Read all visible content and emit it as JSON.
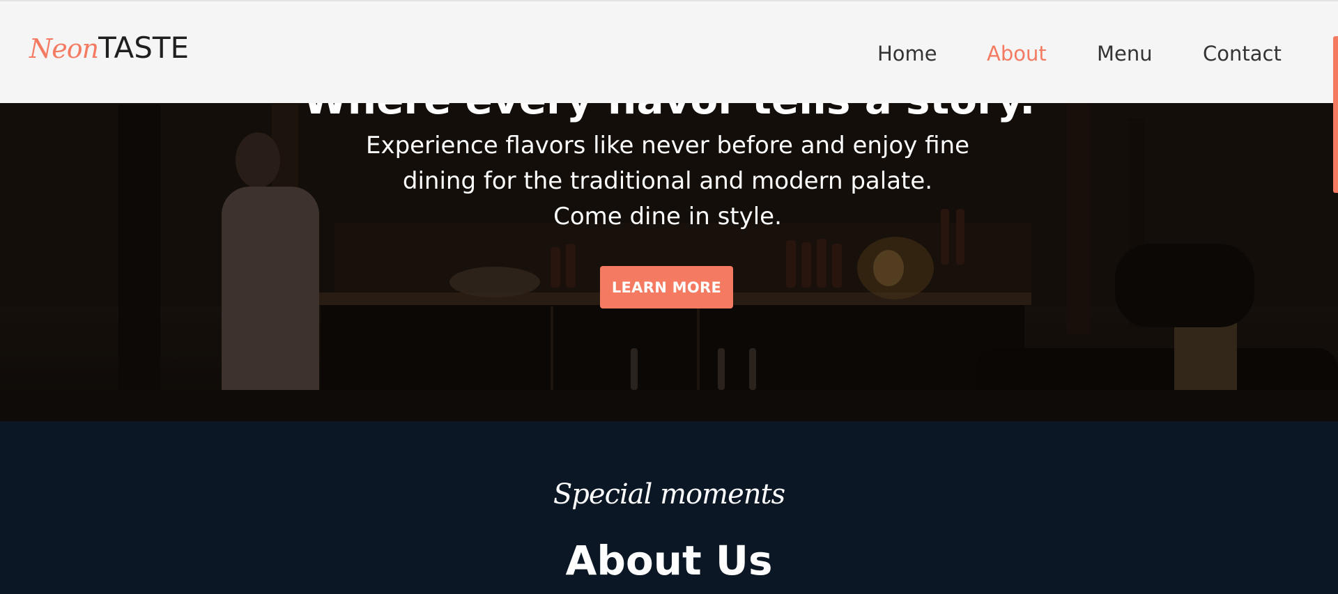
{
  "brand": {
    "logo_script": "Neon",
    "logo_main": "TASTE"
  },
  "nav": {
    "items": [
      {
        "label": "Home",
        "active": false
      },
      {
        "label": "About",
        "active": true
      },
      {
        "label": "Menu",
        "active": false
      },
      {
        "label": "Contact",
        "active": false
      }
    ]
  },
  "hero": {
    "title": "Where every flavor tells a story.",
    "subtitle": "Experience flavors like never before and enjoy fine dining for the traditional and modern palate. Come dine in style.",
    "cta_label": "LEARN MORE"
  },
  "about": {
    "kicker": "Special moments",
    "title": "About Us"
  },
  "colors": {
    "accent": "#f47a62",
    "header_bg": "#f5f5f5",
    "nav_text": "#333333",
    "dark_section": "#0b1724"
  }
}
